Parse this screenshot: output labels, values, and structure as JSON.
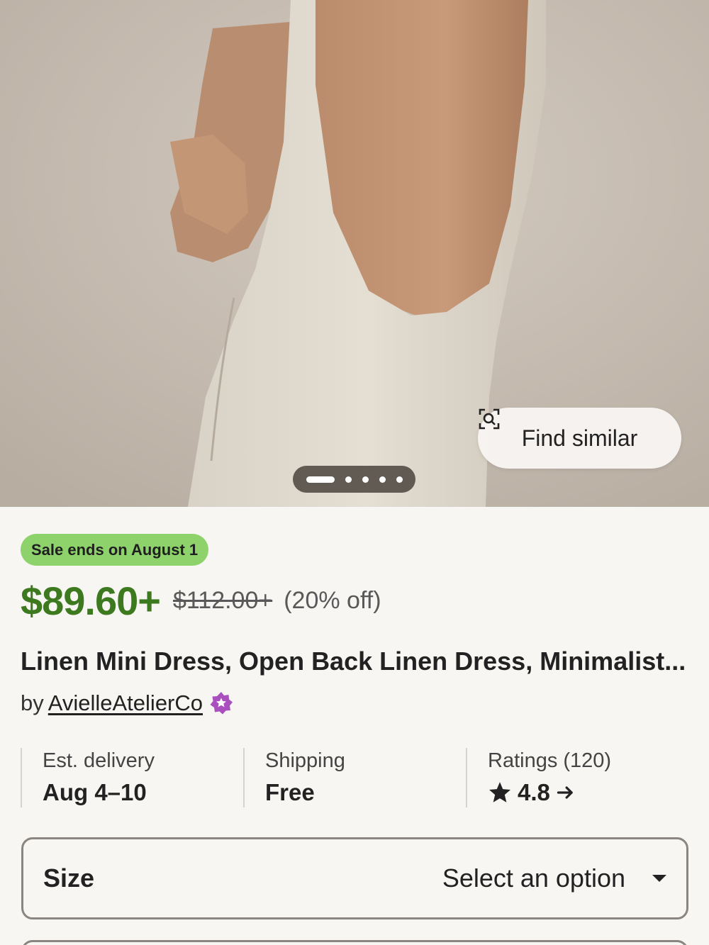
{
  "hero": {
    "find_similar_label": "Find similar",
    "find_similar_icon": "visual-search-icon",
    "carousel": {
      "total_images": 5,
      "active_index": 0
    }
  },
  "product": {
    "sale_badge": "Sale ends on August 1",
    "price": "$89.60+",
    "original_price": "$112.00+",
    "discount": "(20% off)",
    "title": "Linen Mini Dress, Open Back Linen Dress, Minimalist...",
    "seller_prefix": "by",
    "seller_name": "AvielleAtelierCo",
    "seller_badge_icon": "star-seller-icon"
  },
  "info": {
    "delivery_label": "Est. delivery",
    "delivery_value": "Aug 4–10",
    "shipping_label": "Shipping",
    "shipping_value": "Free",
    "ratings_label": "Ratings (120)",
    "ratings_value": "4.8",
    "ratings_icon": "star-icon",
    "ratings_arrow_icon": "arrow-right-icon"
  },
  "options": {
    "size_label": "Size",
    "size_placeholder": "Select an option"
  },
  "colors": {
    "price_green": "#3d7a1f",
    "badge_green": "#8ed26c",
    "star_seller_purple": "#a94fbe",
    "background": "#f8f6f3"
  }
}
